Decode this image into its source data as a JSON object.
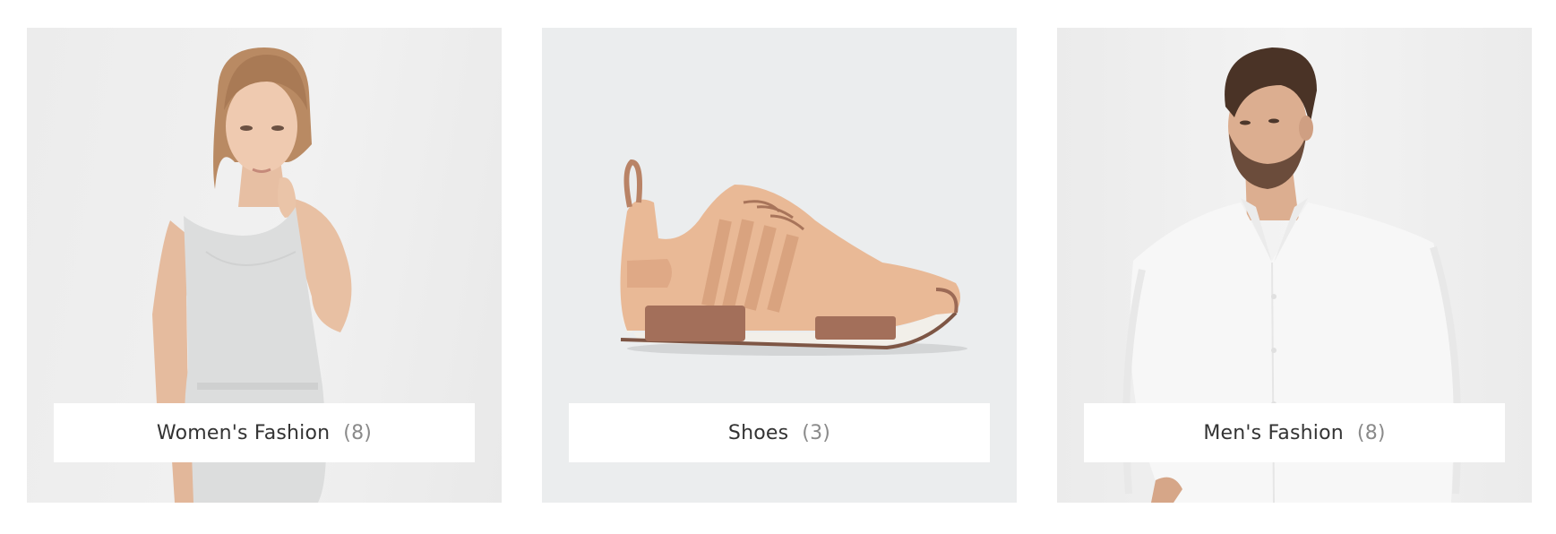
{
  "categories": [
    {
      "label": "Women's Fashion",
      "count": "(8)",
      "icon": "woman-in-linen-dress-photo"
    },
    {
      "label": "Shoes",
      "count": "(3)",
      "icon": "leather-sneaker-photo"
    },
    {
      "label": "Men's Fashion",
      "count": "(8)",
      "icon": "man-in-linen-shirt-photo"
    }
  ],
  "colors": {
    "label_text": "#333333",
    "count_text": "#8a8a8a",
    "card_background": "#ebedee",
    "sneaker_leather": "#e9b996",
    "sneaker_heel": "#a36f5a"
  }
}
